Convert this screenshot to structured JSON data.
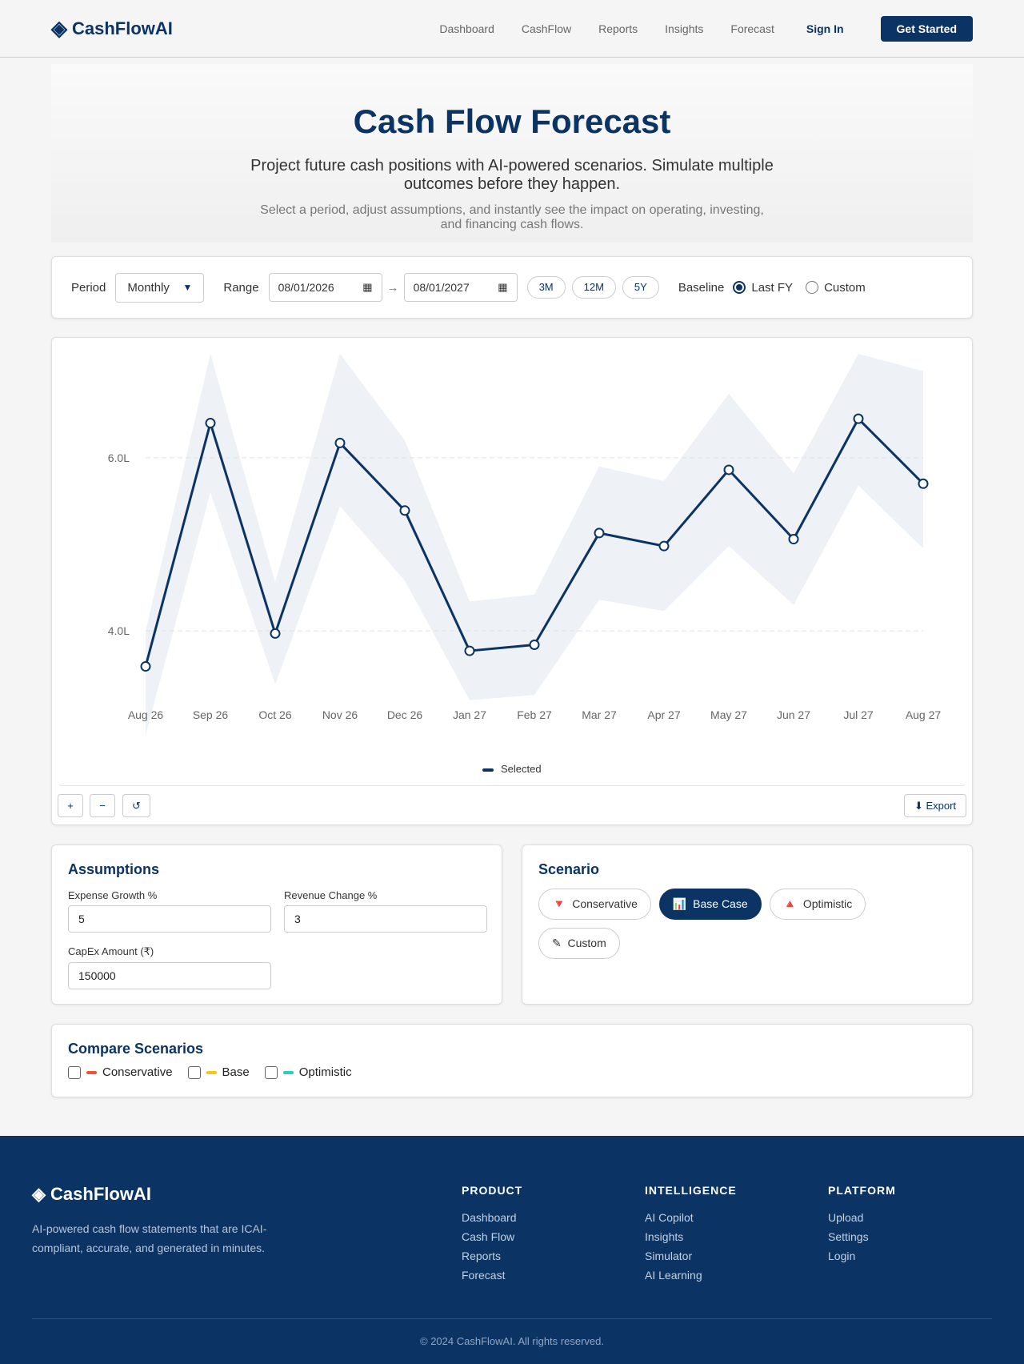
{
  "nav": {
    "brand": "CashFlowAI",
    "brand_icon": "diamond-icon",
    "links": [
      "Dashboard",
      "CashFlow",
      "Reports",
      "Insights",
      "Forecast"
    ],
    "signin": "Sign In",
    "cta": "Get Started"
  },
  "hero": {
    "title": "Cash Flow Forecast",
    "subtitle": "Project future cash positions with AI-powered scenarios. Simulate multiple outcomes before they happen.",
    "description": "Select a period, adjust assumptions, and instantly see the impact on operating, investing, and financing cash flows."
  },
  "controls": {
    "period_label": "Period",
    "period_value": "Monthly",
    "range_label": "Range",
    "start_date": "08/01/2026",
    "end_date": "08/01/2027",
    "arrow": "→",
    "presets": [
      "3M",
      "12M",
      "5Y"
    ],
    "baseline_label": "Baseline",
    "baseline_options": [
      "Last FY",
      "Custom"
    ],
    "baseline_selected": "Last FY"
  },
  "chart_data": {
    "type": "line",
    "x": [
      "Aug 26",
      "Sep 26",
      "Oct 26",
      "Nov 26",
      "Dec 26",
      "Jan 27",
      "Feb 27",
      "Mar 27",
      "Apr 27",
      "May 27",
      "Jun 27",
      "Jul 27",
      "Aug 27"
    ],
    "series": [
      {
        "name": "Selected",
        "values": [
          3.59,
          6.4,
          3.97,
          6.17,
          5.39,
          3.77,
          3.84,
          5.13,
          4.98,
          5.86,
          5.06,
          6.45,
          5.7
        ],
        "color": "#0b3363"
      }
    ],
    "band": {
      "upper": [
        4.0,
        7.2,
        4.56,
        7.2,
        6.2,
        4.34,
        4.42,
        5.9,
        5.73,
        6.74,
        5.82,
        7.2,
        7.0
      ],
      "lower": [
        2.8,
        5.6,
        3.38,
        5.44,
        4.58,
        3.2,
        3.26,
        4.36,
        4.23,
        4.98,
        4.3,
        5.68,
        4.95
      ],
      "color": "#eef1f5"
    },
    "yticks": [
      4.0,
      6.0
    ],
    "ytick_labels": [
      "4.0L",
      "6.0L"
    ],
    "ylim": [
      2.8,
      7.2
    ],
    "grid": "horizontal-dashed",
    "legend": "bottom-center"
  },
  "chart_tools": {
    "zoom_in": "+",
    "zoom_out": "−",
    "reset": "↺",
    "export": "⬇ Export"
  },
  "assumptions": {
    "title": "Assumptions",
    "fields": [
      {
        "label": "Expense Growth %",
        "value": "5"
      },
      {
        "label": "Revenue Change %",
        "value": "3"
      },
      {
        "label": "CapEx Amount (₹)",
        "value": "150000"
      }
    ]
  },
  "scenario": {
    "title": "Scenario",
    "options": [
      {
        "icon": "🔻",
        "label": "Conservative"
      },
      {
        "icon": "📊",
        "label": "Base Case"
      },
      {
        "icon": "🔺",
        "label": "Optimistic"
      },
      {
        "icon": "✎",
        "label": "Custom"
      }
    ],
    "active": "Base Case"
  },
  "compare": {
    "title": "Compare Scenarios",
    "items": [
      {
        "label": "Conservative",
        "color": "#f0533a"
      },
      {
        "label": "Base",
        "color": "#f5c518"
      },
      {
        "label": "Optimistic",
        "color": "#2ccfb7"
      }
    ]
  },
  "footer": {
    "brand": "◈ CashFlowAI",
    "tagline": "AI-powered cash flow statements that are ICAI-compliant, accurate, and generated in minutes.",
    "columns": [
      {
        "heading": "PRODUCT",
        "links": [
          "Dashboard",
          "Cash Flow",
          "Reports",
          "Forecast"
        ]
      },
      {
        "heading": "INTELLIGENCE",
        "links": [
          "AI Copilot",
          "Insights",
          "Simulator",
          "AI Learning"
        ]
      },
      {
        "heading": "PLATFORM",
        "links": [
          "Upload",
          "Settings",
          "Login"
        ]
      }
    ],
    "copyright": "© 2024 CashFlowAI. All rights reserved."
  }
}
